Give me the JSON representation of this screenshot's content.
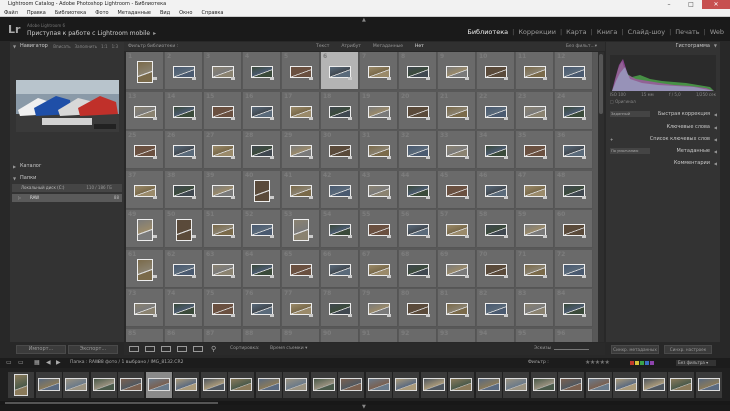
{
  "window": {
    "title": "Lightroom Catalog - Adobe Photoshop Lightroom - Библиотека",
    "minimize": "–",
    "maximize": "□",
    "close": "✕"
  },
  "menu": [
    "Файл",
    "Правка",
    "Библиотека",
    "Фото",
    "Метаданные",
    "Вид",
    "Окно",
    "Справка"
  ],
  "identity": {
    "logo": "Lr",
    "product": "Adobe Lightroom 6",
    "tagline": "Приступая к работе с Lightroom mobile",
    "arrow": "▸",
    "collapse_arrow": "▲"
  },
  "modules": [
    "Библиотека",
    "Коррекции",
    "Карта",
    "Книга",
    "Слайд-шоу",
    "Печать",
    "Web"
  ],
  "left_panel": {
    "navigator": "Навигатор",
    "nav_options": [
      "Вписать",
      "Заполнить",
      "1:1",
      "1:3"
    ],
    "catalog": "Каталог",
    "folders": "Папки",
    "volume": "Локальный диск (C:)",
    "volume_count": "110 / 186 ГБ",
    "folder": "RAW",
    "folder_count": "88",
    "import": "Импорт...",
    "export": "Экспорт..."
  },
  "filter_bar": {
    "label": "Фильтр библиотеки :",
    "options": [
      "Текст",
      "Атрибут",
      "Метаданные",
      "Нет"
    ],
    "active": "Нет",
    "preset": "Без фильт...▾"
  },
  "grid": {
    "start_number": 1,
    "selected_number": 6
  },
  "toolbar": {
    "sort_label": "Сортировка:",
    "sort_value": "Время съемки ▾",
    "thumbs_label": "Эскизы",
    "painter": "⚲"
  },
  "right_panel": {
    "histogram": "Гистограмма",
    "hist_info": [
      "ISO 100",
      "15 мм",
      "f / 5,0",
      "1/250 сек"
    ],
    "original": "Оригинал",
    "quick_dev": "Быстрая коррекция",
    "keywords": "Ключевые слова",
    "keyword_list": "Список ключевых слов",
    "metadata": "Метаданные",
    "comments": "Комментарии",
    "default_preset": "Заданный",
    "default_meta": "По умолчанию",
    "sync_meta": "Синхр. метаданных",
    "sync_settings": "Синхр. настроек"
  },
  "secondary": {
    "source": "Папка : RAW",
    "count": "88 фото / 1 выбрано / IMG_8132.CR2",
    "filter": "Фильтр :",
    "filter_select": "Без фильтра ▾",
    "pages": [
      "1",
      "2"
    ]
  },
  "colors": {
    "accent_sel": "#b4b4b4",
    "filter_red": "#c0392b",
    "filter_yellow": "#d4c13a",
    "filter_green": "#3aa24a",
    "filter_blue": "#3b6fc4",
    "filter_purple": "#8e44ad"
  },
  "filmstrip": {
    "count": 26,
    "selected": 6
  }
}
